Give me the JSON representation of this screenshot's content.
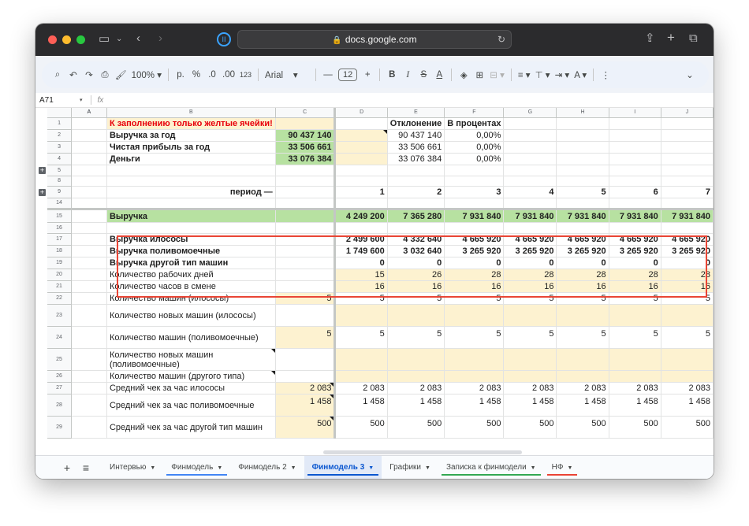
{
  "browser": {
    "url": "docs.google.com"
  },
  "toolbar": {
    "zoom": "100%",
    "currency": "р.",
    "percent": "%",
    "dec_decrease": ".0",
    "dec_increase": ".00",
    "more_formats": "123",
    "font": "Arial",
    "font_size": "12"
  },
  "formula_bar": {
    "cell_ref": "A71",
    "fx": "fx"
  },
  "columns": [
    "A",
    "B",
    "C",
    "D",
    "E",
    "F",
    "G",
    "H",
    "I",
    "J"
  ],
  "cells": {
    "b1": "К заполнению только желтые ячейки!",
    "e1": "Отклонение",
    "f1": "В процентах",
    "b2": "Выручка за год",
    "c2": "90 437 140",
    "e2": "90 437 140",
    "f2": "0,00%",
    "b3": "Чистая прибыль за год",
    "c3": "33 506 661",
    "e3": "33 506 661",
    "f3": "0,00%",
    "b4": "Деньги",
    "c4": "33 076 384",
    "e4": "33 076 384",
    "f4": "0,00%",
    "b9": "период —",
    "periods": [
      "1",
      "2",
      "3",
      "4",
      "5",
      "6",
      "7"
    ],
    "b15": "Выручка",
    "r15": [
      "4 249 200",
      "7 365 280",
      "7 931 840",
      "7 931 840",
      "7 931 840",
      "7 931 840",
      "7 931 840"
    ],
    "b17": "Выручка илососы",
    "r17": [
      "2 499 600",
      "4 332 640",
      "4 665 920",
      "4 665 920",
      "4 665 920",
      "4 665 920",
      "4 665 920"
    ],
    "b18": "Выручка поливомоечные",
    "r18": [
      "1 749 600",
      "3 032 640",
      "3 265 920",
      "3 265 920",
      "3 265 920",
      "3 265 920",
      "3 265 920"
    ],
    "b19": "Выручка другой тип машин",
    "r19": [
      "0",
      "0",
      "0",
      "0",
      "0",
      "0",
      "0"
    ],
    "b20": "Количество рабочих дней",
    "r20": [
      "15",
      "26",
      "28",
      "28",
      "28",
      "28",
      "28"
    ],
    "b21": "Количество часов в смене",
    "r21": [
      "16",
      "16",
      "16",
      "16",
      "16",
      "16",
      "16"
    ],
    "b22": "Количество машин (илососы)",
    "c22": "5",
    "r22": [
      "5",
      "5",
      "5",
      "5",
      "5",
      "5",
      "5"
    ],
    "b23": "Количество новых машин (илососы)",
    "b24": "Количество машин (поливомоечные)",
    "c24": "5",
    "r24": [
      "5",
      "5",
      "5",
      "5",
      "5",
      "5",
      "5"
    ],
    "b25": "Количество новых машин (поливомоечные)",
    "b26": "Количество машин (другого типа)",
    "b27": "Средний чек за час  илососы",
    "c27": "2 083",
    "r27": [
      "2 083",
      "2 083",
      "2 083",
      "2 083",
      "2 083",
      "2 083",
      "2 083"
    ],
    "b28": "Средний чек за час поливомоечные",
    "c28": "1 458",
    "r28": [
      "1 458",
      "1 458",
      "1 458",
      "1 458",
      "1 458",
      "1 458",
      "1 458"
    ],
    "b29": "Средний чек за час другой тип машин",
    "c29": "500",
    "r29": [
      "500",
      "500",
      "500",
      "500",
      "500",
      "500",
      "500"
    ]
  },
  "rows": [
    "1",
    "2",
    "3",
    "4",
    "5",
    "8",
    "9",
    "14",
    "15",
    "16",
    "17",
    "18",
    "19",
    "20",
    "21",
    "22",
    "23",
    "24",
    "25",
    "26",
    "27",
    "28",
    "29"
  ],
  "sheet_tabs": [
    {
      "label": "Интервью"
    },
    {
      "label": "Финмодель"
    },
    {
      "label": "Финмодель 2"
    },
    {
      "label": "Финмодель 3"
    },
    {
      "label": "Графики"
    },
    {
      "label": "Записка к финмодели"
    },
    {
      "label": "НФ"
    }
  ],
  "colors": {
    "yellow_input": "#fdf2d0",
    "green_highlight": "#b7e1a1",
    "red_text": "#e8000b",
    "annotation_box": "#e94535"
  }
}
